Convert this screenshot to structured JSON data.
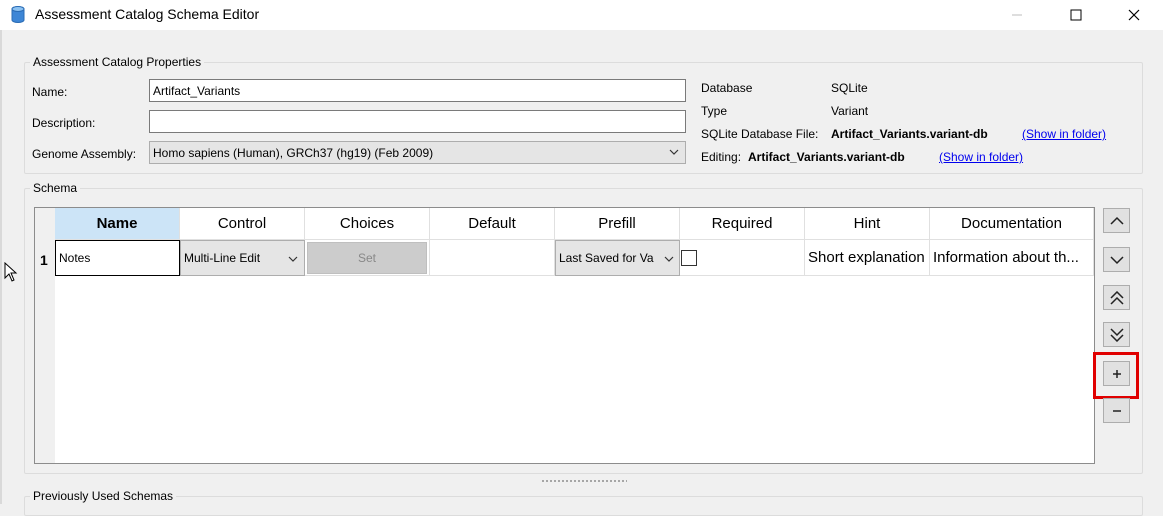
{
  "window": {
    "title": "Assessment Catalog Schema Editor",
    "minimize_glyph": "—",
    "close_glyph": "✕"
  },
  "properties": {
    "group_title": "Assessment Catalog Properties",
    "name_label": "Name:",
    "name_value": "Artifact_Variants",
    "description_label": "Description:",
    "description_value": "",
    "genome_label": "Genome Assembly:",
    "genome_value": "Homo sapiens (Human), GRCh37 (hg19) (Feb 2009)",
    "database_label": "Database",
    "database_value": "SQLite",
    "type_label": "Type",
    "type_value": "Variant",
    "sqlite_file_label": "SQLite Database File:",
    "sqlite_file_value": "Artifact_Variants.variant-db",
    "sqlite_file_link": "(Show in folder)",
    "editing_label": "Editing:",
    "editing_value": "Artifact_Variants.variant-db",
    "editing_link": "(Show in folder)"
  },
  "schema": {
    "group_title": "Schema",
    "columns": [
      "Name",
      "Control",
      "Choices",
      "Default",
      "Prefill",
      "Required",
      "Hint",
      "Documentation"
    ],
    "rows": [
      {
        "num": "1",
        "name": "Notes",
        "control": "Multi-Line Edit",
        "choices_button": "Set",
        "default": "",
        "prefill": "Last Saved for Va",
        "required": false,
        "hint": "Short explanation",
        "documentation": "Information about th..."
      }
    ]
  },
  "side_buttons": [
    "move-up-icon",
    "move-down-icon",
    "move-top-icon",
    "move-bottom-icon",
    "add-icon",
    "remove-icon"
  ],
  "previous": {
    "group_title": "Previously Used Schemas"
  },
  "colors": {
    "highlight": "#e00000",
    "selected_header": "#cce4f7",
    "link": "#0000ee"
  }
}
